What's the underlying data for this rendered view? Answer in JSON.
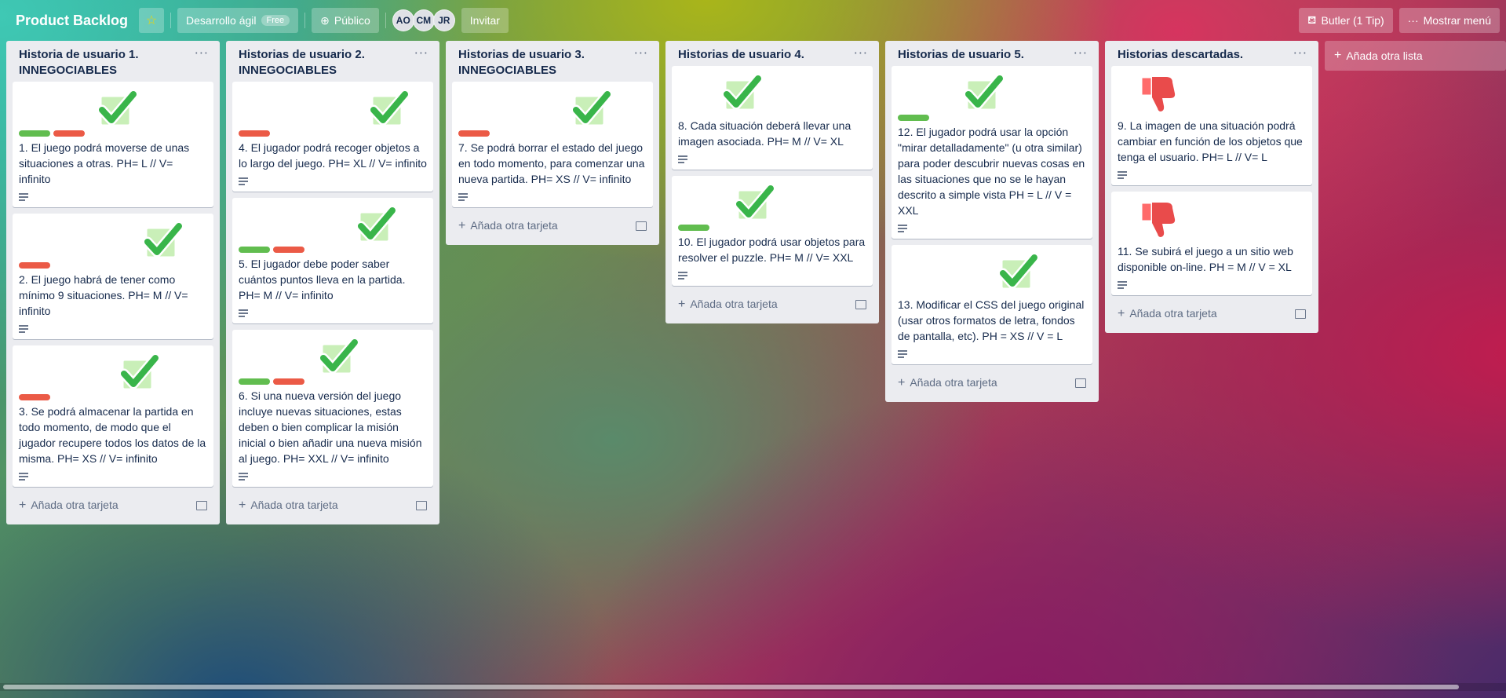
{
  "header": {
    "board_title": "Product Backlog",
    "team_label": "Desarrollo ágil",
    "team_badge": "Free",
    "visibility_label": "Público",
    "members": [
      "AO",
      "CM",
      "JR"
    ],
    "invite_label": "Invitar",
    "butler_label": "Butler (1 Tip)",
    "menu_label": "Mostrar menú"
  },
  "add_card_label": "Añada otra tarjeta",
  "add_list_label": "Añada otra lista",
  "lists": [
    {
      "title": "Historia de usuario 1. INNEGOCIABLES",
      "cards": [
        {
          "text": "1. El juego podrá moverse de unas situaciones a otras. PH= L // V= infinito",
          "labels": [
            "green",
            "red"
          ],
          "sticker": "check-sticker"
        },
        {
          "text": "2. El juego habrá de tener como mínimo 9 situaciones. PH= M // V= infinito",
          "labels": [
            "red"
          ],
          "sticker": "check-sticker"
        },
        {
          "text": "3. Se podrá almacenar la partida en todo momento, de modo que el jugador recupere todos los datos de la misma. PH= XS // V= infinito",
          "labels": [
            "red"
          ],
          "sticker": "check-sticker"
        }
      ]
    },
    {
      "title": "Historias de usuario 2. INNEGOCIABLES",
      "cards": [
        {
          "text": "4. El jugador podrá recoger objetos a lo largo del juego. PH= XL // V= infinito",
          "labels": [
            "red"
          ],
          "sticker": "check-sticker"
        },
        {
          "text": "5. El jugador debe poder saber cuántos puntos lleva en la partida. PH= M // V= infinito",
          "labels": [
            "green",
            "red"
          ],
          "sticker": "check-sticker"
        },
        {
          "text": "6. Si una nueva versión del juego incluye nuevas situaciones, estas deben o bien complicar la misión inicial o bien añadir una nueva misión al juego. PH= XXL // V= infinito",
          "labels": [
            "green",
            "red"
          ],
          "sticker": "check-sticker"
        }
      ]
    },
    {
      "title": "Historias de usuario 3. INNEGOCIABLES",
      "cards": [
        {
          "text": "7. Se podrá borrar el estado del juego en todo momento, para comenzar una nueva partida. PH= XS // V= infinito",
          "labels": [
            "red"
          ],
          "sticker": "check-sticker"
        }
      ]
    },
    {
      "title": "Historias de usuario 4.",
      "cards": [
        {
          "text": "8. Cada situación deberá llevar una imagen asociada. PH= M // V= XL",
          "labels": [],
          "sticker": "check-sticker"
        },
        {
          "text": "10. El jugador podrá usar objetos para resolver el puzzle. PH= M // V= XXL",
          "labels": [
            "green"
          ],
          "sticker": "check-sticker"
        }
      ]
    },
    {
      "title": "Historias de usuario 5.",
      "cards": [
        {
          "text": "12. El jugador podrá usar la opción \"mirar detalladamente\" (u otra similar) para poder descubrir nuevas cosas en las situaciones que no se le hayan descrito a simple vista PH = L // V = XXL",
          "labels": [
            "green"
          ],
          "sticker": "check-sticker"
        },
        {
          "text": "13. Modificar el CSS del juego original (usar otros formatos de letra, fondos de pantalla, etc). PH = XS // V = L",
          "labels": [],
          "sticker": "check-sticker"
        }
      ]
    },
    {
      "title": "Historias descartadas.",
      "cards": [
        {
          "text": "9. La imagen de una situación podrá cambiar en función de los objetos que tenga el usuario. PH= L // V= L",
          "labels": [],
          "sticker": "thumbs-down-sticker"
        },
        {
          "text": "11. Se subirá el juego a un sitio web disponible on-line. PH = M // V = XL",
          "labels": [],
          "sticker": "thumbs-down-sticker"
        }
      ]
    }
  ]
}
